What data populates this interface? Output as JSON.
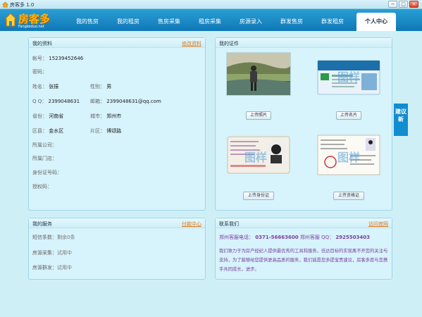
{
  "window": {
    "title": "房客多 1.0",
    "min": "−",
    "max": "□",
    "close": "×"
  },
  "logo": {
    "text": "房客多",
    "sub": "Fangkeduo.net"
  },
  "nav": {
    "tabs": [
      "我的售房",
      "我的租房",
      "售房采集",
      "租房采集",
      "房源录入",
      "群发售房",
      "群发租房",
      "个人中心"
    ],
    "active": 7
  },
  "profile": {
    "title": "我的资料",
    "edit": "修改资料",
    "account_label": "帐号：",
    "account": "15239452646",
    "password_label": "密码：",
    "name_label": "姓名：",
    "name": "张振",
    "gender_label": "性别：",
    "gender": "男",
    "qq_label": "Q Q：",
    "qq": "2399048631",
    "email_label": "邮箱：",
    "email": "2399048631@qq.com",
    "province_label": "省份：",
    "province": "河南省",
    "city_label": "城市：",
    "city": "郑州市",
    "district_label": "区县：",
    "district": "金水区",
    "area_label": "片区：",
    "area": "博颂路",
    "company_label": "所属公司：",
    "store_label": "所属门店：",
    "id_label": "身份证号码：",
    "auth_label": "授权码："
  },
  "docs": {
    "title": "我的证件",
    "upload_photo": "上传照片",
    "upload_card": "上传名片",
    "upload_id": "上传身份证",
    "upload_cert": "上传资格证",
    "watermark": "图样"
  },
  "service": {
    "title": "我的服务",
    "link": "付款中心",
    "sms_label": "短信条数：",
    "sms": "剩余0条",
    "collect_label": "房源采集：",
    "collect": "试用中",
    "broadcast_label": "房源群发：",
    "broadcast": "试用中"
  },
  "contact": {
    "title": "联系我们",
    "link": "访问官网",
    "phone_label": "郑州客服电话：",
    "phone": "0371-56663600",
    "qq_label": "郑州客服 QQ：",
    "qq": "2925503403",
    "desc": "我们致力于为房产经纪人提供最优秀的工具和服务，倍达目标的实现离不开您的关注与支持，为了能够给您提供更高品质的服务，我们诚恳您多提宝贵建议，房客多愿与您携手共同成长，进步。"
  },
  "sidetab": {
    "text": "建议新"
  }
}
